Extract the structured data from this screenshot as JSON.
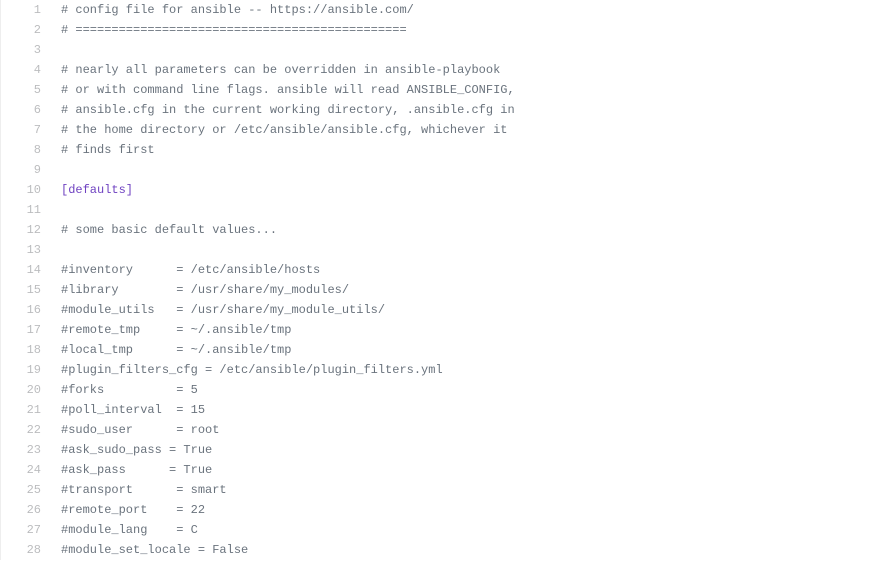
{
  "lines": [
    {
      "num": "1",
      "type": "comment",
      "text": "# config file for ansible -- https://ansible.com/"
    },
    {
      "num": "2",
      "type": "comment",
      "text": "# =============================================="
    },
    {
      "num": "3",
      "type": "blank",
      "text": ""
    },
    {
      "num": "4",
      "type": "comment",
      "text": "# nearly all parameters can be overridden in ansible-playbook"
    },
    {
      "num": "5",
      "type": "comment",
      "text": "# or with command line flags. ansible will read ANSIBLE_CONFIG,"
    },
    {
      "num": "6",
      "type": "comment",
      "text": "# ansible.cfg in the current working directory, .ansible.cfg in"
    },
    {
      "num": "7",
      "type": "comment",
      "text": "# the home directory or /etc/ansible/ansible.cfg, whichever it"
    },
    {
      "num": "8",
      "type": "comment",
      "text": "# finds first"
    },
    {
      "num": "9",
      "type": "blank",
      "text": ""
    },
    {
      "num": "10",
      "type": "section",
      "text": "[defaults]"
    },
    {
      "num": "11",
      "type": "blank",
      "text": ""
    },
    {
      "num": "12",
      "type": "comment",
      "text": "# some basic default values..."
    },
    {
      "num": "13",
      "type": "blank",
      "text": ""
    },
    {
      "num": "14",
      "type": "comment",
      "text": "#inventory      = /etc/ansible/hosts"
    },
    {
      "num": "15",
      "type": "comment",
      "text": "#library        = /usr/share/my_modules/"
    },
    {
      "num": "16",
      "type": "comment",
      "text": "#module_utils   = /usr/share/my_module_utils/"
    },
    {
      "num": "17",
      "type": "comment",
      "text": "#remote_tmp     = ~/.ansible/tmp"
    },
    {
      "num": "18",
      "type": "comment",
      "text": "#local_tmp      = ~/.ansible/tmp"
    },
    {
      "num": "19",
      "type": "comment",
      "text": "#plugin_filters_cfg = /etc/ansible/plugin_filters.yml"
    },
    {
      "num": "20",
      "type": "comment",
      "text": "#forks          = 5"
    },
    {
      "num": "21",
      "type": "comment",
      "text": "#poll_interval  = 15"
    },
    {
      "num": "22",
      "type": "comment",
      "text": "#sudo_user      = root"
    },
    {
      "num": "23",
      "type": "comment",
      "text": "#ask_sudo_pass = True"
    },
    {
      "num": "24",
      "type": "comment",
      "text": "#ask_pass      = True"
    },
    {
      "num": "25",
      "type": "comment",
      "text": "#transport      = smart"
    },
    {
      "num": "26",
      "type": "comment",
      "text": "#remote_port    = 22"
    },
    {
      "num": "27",
      "type": "comment",
      "text": "#module_lang    = C"
    },
    {
      "num": "28",
      "type": "comment",
      "text": "#module_set_locale = False"
    }
  ]
}
